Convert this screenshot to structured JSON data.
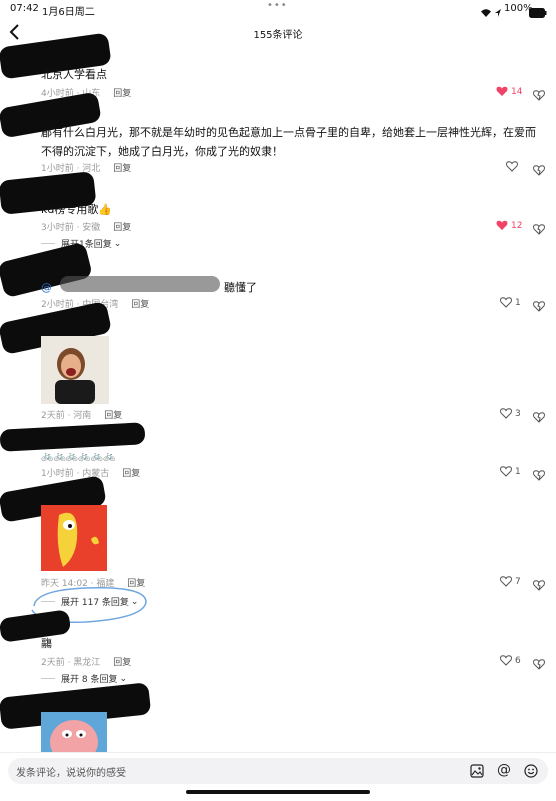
{
  "status_bar": {
    "time": "07:42",
    "date": "1月6日周二",
    "dots": "•••",
    "battery": "100%"
  },
  "header": {
    "title": "155条评论"
  },
  "comments": [
    {
      "text": "北京人学看点",
      "meta": "4小时前 · 山东",
      "reply": "回复",
      "likes": "14",
      "liked": true
    },
    {
      "text": "郿有什么白月光，那不就是年幼时的见色起意加上一点骨子里的自卑，给她套上一层神性光辉，在爱而不得的沉淀下，她成了白月光，你成了光的奴隶！",
      "meta": "1小时前 · 河北",
      "reply": "回复",
      "likes": "",
      "liked": false
    },
    {
      "text": "kd榜专用歌👍",
      "meta": "3小时前 · 安徽",
      "reply": "回复",
      "likes": "12",
      "liked": true,
      "expand": "展开1条回复"
    },
    {
      "text": "@ 聽懂了",
      "meta": "2小时前 · 中国台湾",
      "reply": "回复",
      "likes": "1",
      "liked": false
    },
    {
      "text": "",
      "meta": "2天前 · 河南",
      "reply": "回复",
      "likes": "3",
      "liked": false,
      "image": "laughing-woman-sticker"
    },
    {
      "text": "🚲🚲🚲🚲🚲🚲",
      "meta": "1小时前 · 内蒙古",
      "reply": "回复",
      "likes": "1",
      "liked": false
    },
    {
      "text": "",
      "meta": "昨天 14:02 · 福建",
      "reply": "回复",
      "likes": "7",
      "liked": false,
      "image": "cartoon-banana-sticker",
      "expand": "展开 117 条回复"
    },
    {
      "text": "鬺",
      "meta": "2天前 · 黑龙江",
      "reply": "回复",
      "likes": "6",
      "liked": false,
      "expand": "展开 8 条回复"
    },
    {
      "text": "",
      "image": "pink-starfish-sticker"
    }
  ],
  "input_bar": {
    "placeholder": "发条评论，说说你的感受"
  },
  "colors": {
    "like_red": "#f04366",
    "annotation_blue": "#6fa6e0"
  }
}
